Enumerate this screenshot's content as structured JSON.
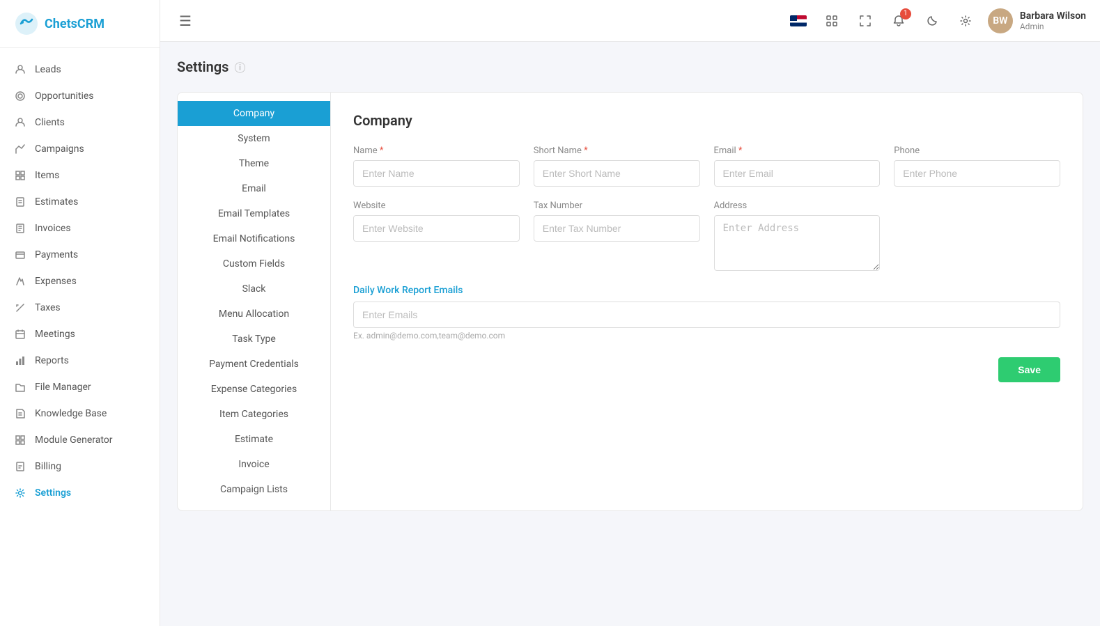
{
  "app": {
    "name": "ChetsCRM",
    "logo_text": "ChetsCRM"
  },
  "header": {
    "menu_icon": "☰",
    "notification_count": "1",
    "user": {
      "name": "Barbara Wilson",
      "role": "Admin",
      "initials": "BW"
    }
  },
  "sidebar": {
    "items": [
      {
        "id": "leads",
        "label": "Leads",
        "icon": "leads"
      },
      {
        "id": "opportunities",
        "label": "Opportunities",
        "icon": "opportunities"
      },
      {
        "id": "clients",
        "label": "Clients",
        "icon": "clients"
      },
      {
        "id": "campaigns",
        "label": "Campaigns",
        "icon": "campaigns"
      },
      {
        "id": "items",
        "label": "Items",
        "icon": "items"
      },
      {
        "id": "estimates",
        "label": "Estimates",
        "icon": "estimates"
      },
      {
        "id": "invoices",
        "label": "Invoices",
        "icon": "invoices"
      },
      {
        "id": "payments",
        "label": "Payments",
        "icon": "payments"
      },
      {
        "id": "expenses",
        "label": "Expenses",
        "icon": "expenses"
      },
      {
        "id": "taxes",
        "label": "Taxes",
        "icon": "taxes"
      },
      {
        "id": "meetings",
        "label": "Meetings",
        "icon": "meetings"
      },
      {
        "id": "reports",
        "label": "Reports",
        "icon": "reports"
      },
      {
        "id": "file-manager",
        "label": "File Manager",
        "icon": "file-manager"
      },
      {
        "id": "knowledge-base",
        "label": "Knowledge Base",
        "icon": "knowledge-base"
      },
      {
        "id": "module-generator",
        "label": "Module Generator",
        "icon": "module-generator"
      },
      {
        "id": "billing",
        "label": "Billing",
        "icon": "billing"
      },
      {
        "id": "settings",
        "label": "Settings",
        "icon": "settings",
        "active": true
      }
    ]
  },
  "page": {
    "title": "Settings"
  },
  "settings_sidebar": {
    "items": [
      {
        "id": "company",
        "label": "Company",
        "active": true
      },
      {
        "id": "system",
        "label": "System"
      },
      {
        "id": "theme",
        "label": "Theme"
      },
      {
        "id": "email",
        "label": "Email"
      },
      {
        "id": "email-templates",
        "label": "Email Templates"
      },
      {
        "id": "email-notifications",
        "label": "Email Notifications"
      },
      {
        "id": "custom-fields",
        "label": "Custom Fields"
      },
      {
        "id": "slack",
        "label": "Slack"
      },
      {
        "id": "menu-allocation",
        "label": "Menu Allocation"
      },
      {
        "id": "task-type",
        "label": "Task Type"
      },
      {
        "id": "payment-credentials",
        "label": "Payment Credentials"
      },
      {
        "id": "expense-categories",
        "label": "Expense Categories"
      },
      {
        "id": "item-categories",
        "label": "Item Categories"
      },
      {
        "id": "estimate",
        "label": "Estimate"
      },
      {
        "id": "invoice",
        "label": "Invoice"
      },
      {
        "id": "campaign-lists",
        "label": "Campaign Lists"
      }
    ]
  },
  "company_form": {
    "title": "Company",
    "fields": {
      "name": {
        "label": "Name",
        "required": true,
        "placeholder": "Enter Name"
      },
      "short_name": {
        "label": "Short Name",
        "required": true,
        "placeholder": "Enter Short Name"
      },
      "email": {
        "label": "Email",
        "required": true,
        "placeholder": "Enter Email"
      },
      "phone": {
        "label": "Phone",
        "required": false,
        "placeholder": "Enter Phone"
      },
      "website": {
        "label": "Website",
        "required": false,
        "placeholder": "Enter Website"
      },
      "tax_number": {
        "label": "Tax Number",
        "required": false,
        "placeholder": "Enter Tax Number"
      },
      "address": {
        "label": "Address",
        "required": false,
        "placeholder": "Enter Address"
      }
    },
    "daily_report": {
      "label": "Daily Work Report Emails",
      "placeholder": "Enter Emails",
      "hint": "Ex. admin@demo.com,team@demo.com"
    },
    "save_button": "Save"
  }
}
